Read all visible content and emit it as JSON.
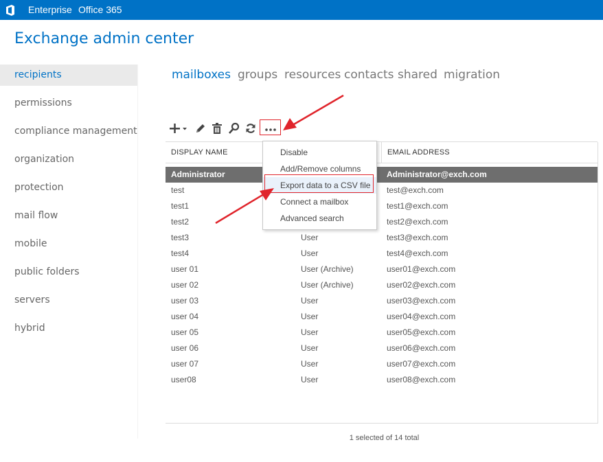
{
  "topbar": {
    "nav": [
      "Enterprise",
      "Office 365"
    ],
    "icon": "office-logo-icon",
    "background": "#0072c6"
  },
  "app": {
    "title": "Exchange admin center"
  },
  "sidebar": {
    "items": [
      {
        "label": "recipients",
        "active": true
      },
      {
        "label": "permissions"
      },
      {
        "label": "compliance management"
      },
      {
        "label": "organization"
      },
      {
        "label": "protection"
      },
      {
        "label": "mail flow"
      },
      {
        "label": "mobile"
      },
      {
        "label": "public folders"
      },
      {
        "label": "servers"
      },
      {
        "label": "hybrid"
      }
    ]
  },
  "tabs": [
    {
      "label": "mailboxes",
      "active": true
    },
    {
      "label": "groups"
    },
    {
      "label": "resources"
    },
    {
      "label": "contacts"
    },
    {
      "label": "shared"
    },
    {
      "label": "migration"
    }
  ],
  "toolbar": {
    "icons": [
      "add-icon",
      "edit-icon",
      "delete-icon",
      "search-icon",
      "refresh-icon",
      "more-icon"
    ]
  },
  "table": {
    "columns": [
      "DISPLAY NAME",
      "EMAIL ADDRESS"
    ],
    "rows": [
      {
        "name": "Administrator",
        "type": "",
        "email": "Administrator@exch.com",
        "selected": true
      },
      {
        "name": "test",
        "type": "",
        "email": "test@exch.com"
      },
      {
        "name": "test1",
        "type": "",
        "email": "test1@exch.com"
      },
      {
        "name": "test2",
        "type": "",
        "email": "test2@exch.com"
      },
      {
        "name": "test3",
        "type": "User",
        "email": "test3@exch.com"
      },
      {
        "name": "test4",
        "type": "User",
        "email": "test4@exch.com"
      },
      {
        "name": "user 01",
        "type": "User (Archive)",
        "email": "user01@exch.com"
      },
      {
        "name": "user 02",
        "type": "User (Archive)",
        "email": "user02@exch.com"
      },
      {
        "name": "user 03",
        "type": "User",
        "email": "user03@exch.com"
      },
      {
        "name": "user 04",
        "type": "User",
        "email": "user04@exch.com"
      },
      {
        "name": "user 05",
        "type": "User",
        "email": "user05@exch.com"
      },
      {
        "name": "user 06",
        "type": "User",
        "email": "user06@exch.com"
      },
      {
        "name": "user 07",
        "type": "User",
        "email": "user07@exch.com"
      },
      {
        "name": "user08",
        "type": "User",
        "email": "user08@exch.com"
      }
    ]
  },
  "menu": {
    "items": [
      {
        "label": "Disable"
      },
      {
        "label": "Add/Remove columns"
      },
      {
        "label": "Export data to a CSV file",
        "highlighted": true
      },
      {
        "label": "Connect a mailbox"
      },
      {
        "label": "Advanced search"
      }
    ]
  },
  "status": {
    "text": "1 selected of 14 total"
  },
  "colors": {
    "accent": "#0072c6",
    "annotation": "#e0242b",
    "selected_row": "#6e6e6e"
  }
}
